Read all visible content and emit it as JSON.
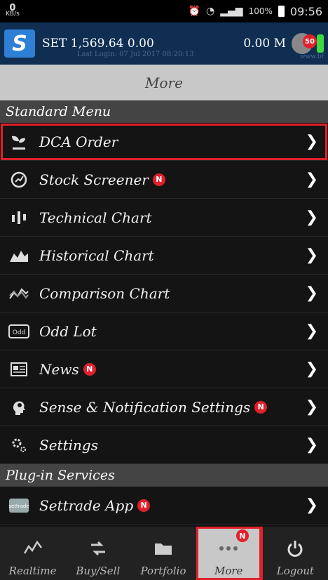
{
  "status": {
    "kbs_value": "0",
    "kbs_unit": "KB/s",
    "battery": "100%",
    "time": "09:56"
  },
  "ticker": {
    "logo_text": "S",
    "set_label": "SET 1,569.64 0.00",
    "volume": "0.00 M",
    "last_login": "Last Login: 07 Jul 2017 08:20:13",
    "notification_count": "50",
    "site": "www.bf"
  },
  "page": {
    "title": "More"
  },
  "sections": {
    "standard": "Standard Menu",
    "plugin": "Plug-in Services"
  },
  "menu": [
    {
      "label": "DCA Order",
      "icon": "plant-icon",
      "new": false
    },
    {
      "label": "Stock Screener",
      "icon": "screener-icon",
      "new": true
    },
    {
      "label": "Technical Chart",
      "icon": "candlestick-icon",
      "new": false
    },
    {
      "label": "Historical Chart",
      "icon": "area-chart-icon",
      "new": false
    },
    {
      "label": "Comparison Chart",
      "icon": "compare-icon",
      "new": false
    },
    {
      "label": "Odd Lot",
      "icon": "odd-lot-icon",
      "new": false
    },
    {
      "label": "News",
      "icon": "news-icon",
      "new": true
    },
    {
      "label": "Sense & Notification Settings",
      "icon": "sense-icon",
      "new": true
    },
    {
      "label": "Settings",
      "icon": "gear-icon",
      "new": false
    }
  ],
  "plugins": [
    {
      "label": "Settrade App",
      "icon": "settrade-app-icon",
      "new": true
    }
  ],
  "new_badge": "N",
  "nav": [
    {
      "label": "Realtime",
      "icon": "realtime-icon"
    },
    {
      "label": "Buy/Sell",
      "icon": "buy-sell-icon"
    },
    {
      "label": "Portfolio",
      "icon": "folder-icon"
    },
    {
      "label": "More",
      "icon": "more-icon"
    },
    {
      "label": "Logout",
      "icon": "power-icon"
    }
  ],
  "colors": {
    "highlight": "#e0202a",
    "ticker_bg": "#0f2e52",
    "section_bg": "#444444",
    "title_bg": "#c8c8c8"
  }
}
